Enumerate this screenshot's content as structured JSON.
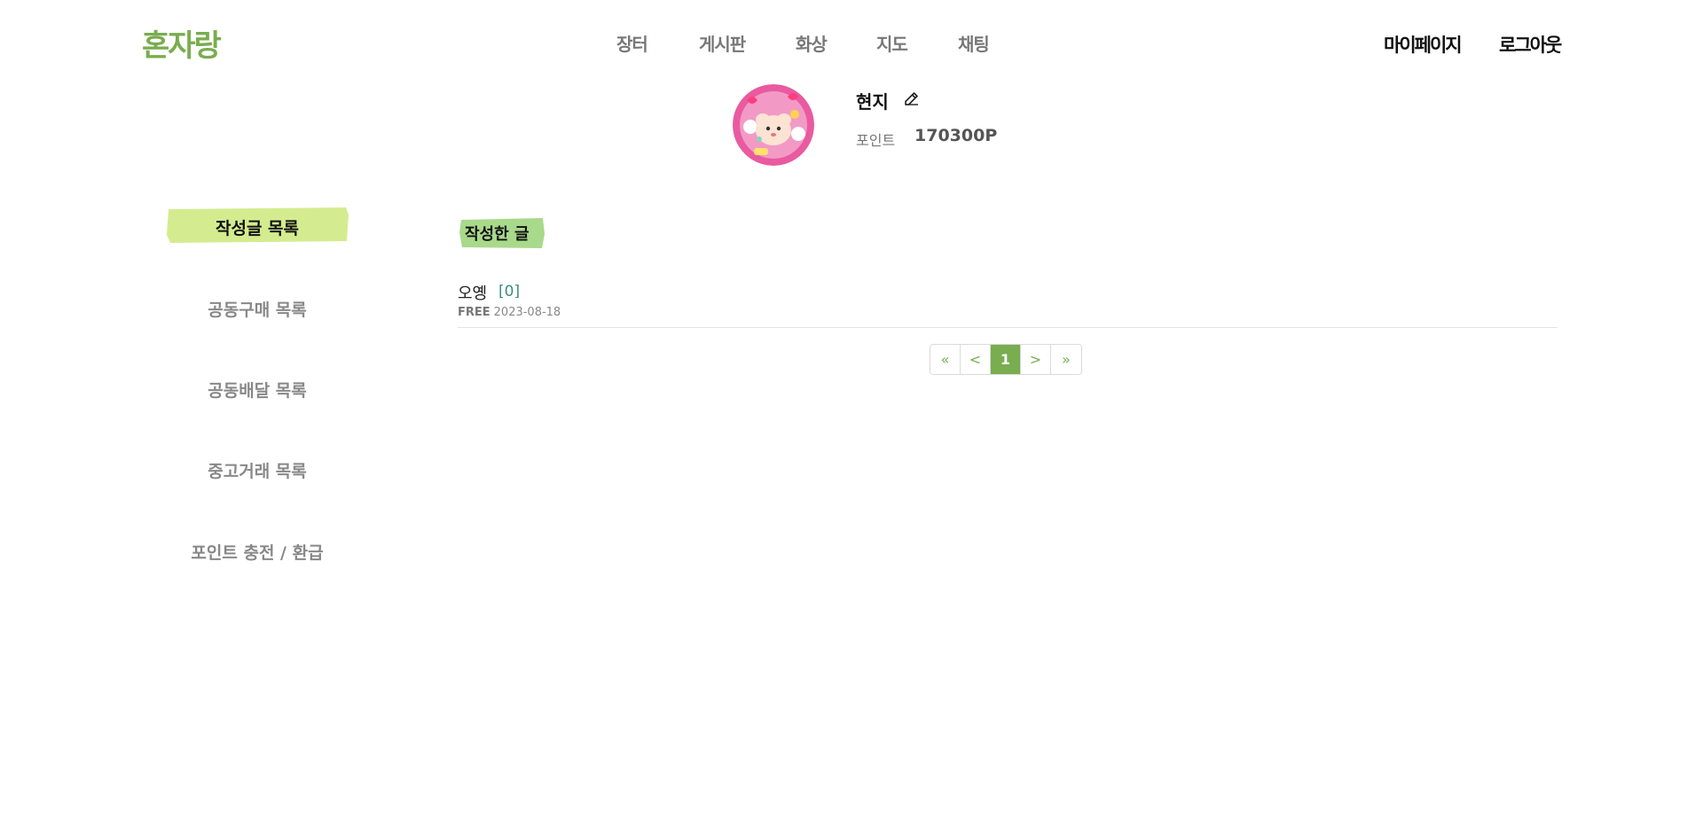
{
  "header": {
    "logo": "혼자랑",
    "nav": [
      "장터",
      "게시판",
      "화상",
      "지도",
      "채팅"
    ],
    "mypage": "마이페이지",
    "logout": "로그아웃"
  },
  "profile": {
    "name": "현지",
    "point_label": "포인트",
    "point_value": "170300P"
  },
  "sidebar": {
    "items": [
      "작성글 목록",
      "공동구매 목록",
      "공동배달 목록",
      "중고거래 목록",
      "포인트 충전 / 환급"
    ],
    "active": "작성글 목록"
  },
  "main": {
    "section_title": "작성한 글",
    "posts": [
      {
        "title": "오옝",
        "comments": "[0]",
        "category": "FREE",
        "date": "2023-08-18"
      }
    ]
  },
  "pagination": {
    "first": "«",
    "prev": "<",
    "current": "1",
    "next": ">",
    "last": "»"
  },
  "colors": {
    "brand": "#79ad4f",
    "highlight_sidebar": "#d4ec8f",
    "highlight_section": "#a9d98a",
    "comment_count": "#3a8f7a"
  }
}
